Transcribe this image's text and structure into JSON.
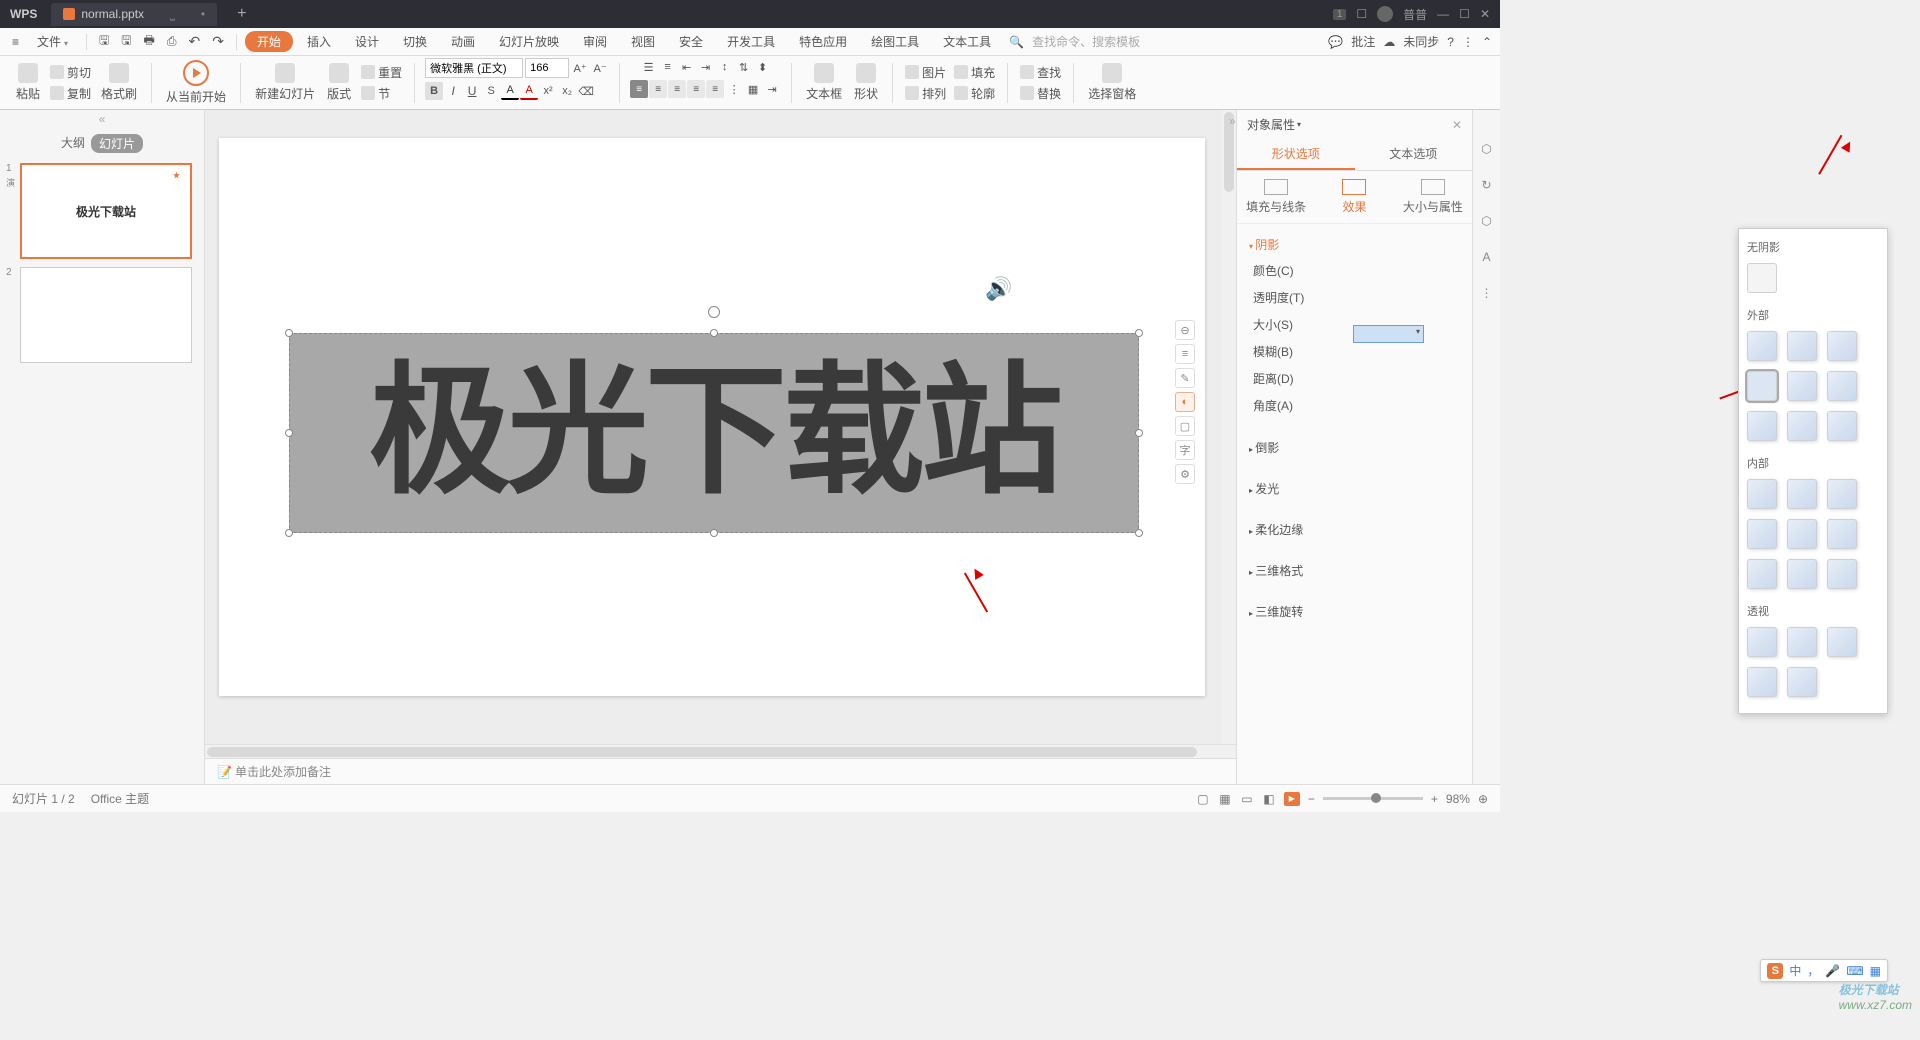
{
  "titlebar": {
    "app": "WPS",
    "tab_name": "normal.pptx",
    "badge": "1",
    "user": "普普"
  },
  "menubar": {
    "file": "文件",
    "tabs": [
      "开始",
      "插入",
      "设计",
      "切换",
      "动画",
      "幻灯片放映",
      "审阅",
      "视图",
      "安全",
      "开发工具",
      "特色应用",
      "绘图工具",
      "文本工具"
    ],
    "search_placeholder": "查找命令、搜索模板",
    "review": "批注",
    "sync": "未同步"
  },
  "ribbon": {
    "paste": "粘贴",
    "cut": "剪切",
    "copy": "复制",
    "format_painter": "格式刷",
    "play_from": "从当前开始",
    "new_slide": "新建幻灯片",
    "layout": "版式",
    "section": "节",
    "reset": "重置",
    "font_name": "微软雅黑 (正文)",
    "font_size": "166",
    "textbox": "文本框",
    "shape": "形状",
    "picture": "图片",
    "arrange": "排列",
    "fill": "填充",
    "outline": "轮廓",
    "find": "查找",
    "replace": "替换",
    "select_pane": "选择窗格"
  },
  "slide_panel": {
    "outline": "大纲",
    "slides": "幻灯片",
    "label1": "演",
    "slide1_text": "极光下载站"
  },
  "canvas": {
    "big_text": "极光下载站",
    "notes_placeholder": "单击此处添加备注"
  },
  "properties": {
    "title": "对象属性",
    "tab_shape": "形状选项",
    "tab_text": "文本选项",
    "sub_fill": "填充与线条",
    "sub_effect": "效果",
    "sub_size": "大小与属性",
    "sec_shadow": "阴影",
    "color": "颜色(C)",
    "transparency": "透明度(T)",
    "size": "大小(S)",
    "blur": "模糊(B)",
    "distance": "距离(D)",
    "angle": "角度(A)",
    "sec_reflection": "倒影",
    "sec_glow": "发光",
    "sec_soft": "柔化边缘",
    "sec_3d_format": "三维格式",
    "sec_3d_rotate": "三维旋转"
  },
  "shadow_popup": {
    "none": "无阴影",
    "outer": "外部",
    "inner": "内部",
    "perspective": "透视"
  },
  "ime": {
    "cn": "中"
  },
  "statusbar": {
    "slide_pos": "幻灯片 1 / 2",
    "theme": "Office 主题",
    "zoom": "98%"
  },
  "watermark": {
    "brand": "极光下载站",
    "url": "www.xz7.com"
  }
}
